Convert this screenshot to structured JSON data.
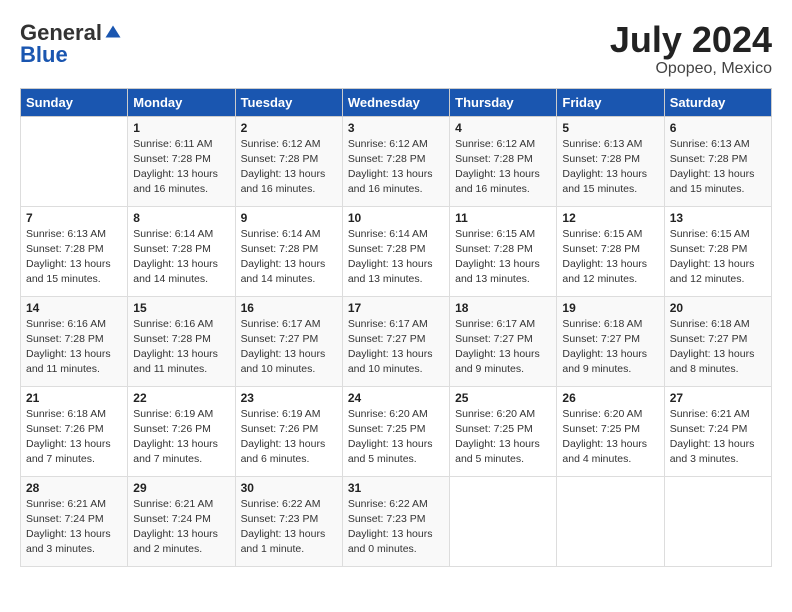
{
  "header": {
    "logo_general": "General",
    "logo_blue": "Blue",
    "month": "July 2024",
    "location": "Opopeo, Mexico"
  },
  "days_of_week": [
    "Sunday",
    "Monday",
    "Tuesday",
    "Wednesday",
    "Thursday",
    "Friday",
    "Saturday"
  ],
  "weeks": [
    [
      {
        "num": "",
        "info": ""
      },
      {
        "num": "1",
        "info": "Sunrise: 6:11 AM\nSunset: 7:28 PM\nDaylight: 13 hours\nand 16 minutes."
      },
      {
        "num": "2",
        "info": "Sunrise: 6:12 AM\nSunset: 7:28 PM\nDaylight: 13 hours\nand 16 minutes."
      },
      {
        "num": "3",
        "info": "Sunrise: 6:12 AM\nSunset: 7:28 PM\nDaylight: 13 hours\nand 16 minutes."
      },
      {
        "num": "4",
        "info": "Sunrise: 6:12 AM\nSunset: 7:28 PM\nDaylight: 13 hours\nand 16 minutes."
      },
      {
        "num": "5",
        "info": "Sunrise: 6:13 AM\nSunset: 7:28 PM\nDaylight: 13 hours\nand 15 minutes."
      },
      {
        "num": "6",
        "info": "Sunrise: 6:13 AM\nSunset: 7:28 PM\nDaylight: 13 hours\nand 15 minutes."
      }
    ],
    [
      {
        "num": "7",
        "info": "Sunrise: 6:13 AM\nSunset: 7:28 PM\nDaylight: 13 hours\nand 15 minutes."
      },
      {
        "num": "8",
        "info": "Sunrise: 6:14 AM\nSunset: 7:28 PM\nDaylight: 13 hours\nand 14 minutes."
      },
      {
        "num": "9",
        "info": "Sunrise: 6:14 AM\nSunset: 7:28 PM\nDaylight: 13 hours\nand 14 minutes."
      },
      {
        "num": "10",
        "info": "Sunrise: 6:14 AM\nSunset: 7:28 PM\nDaylight: 13 hours\nand 13 minutes."
      },
      {
        "num": "11",
        "info": "Sunrise: 6:15 AM\nSunset: 7:28 PM\nDaylight: 13 hours\nand 13 minutes."
      },
      {
        "num": "12",
        "info": "Sunrise: 6:15 AM\nSunset: 7:28 PM\nDaylight: 13 hours\nand 12 minutes."
      },
      {
        "num": "13",
        "info": "Sunrise: 6:15 AM\nSunset: 7:28 PM\nDaylight: 13 hours\nand 12 minutes."
      }
    ],
    [
      {
        "num": "14",
        "info": "Sunrise: 6:16 AM\nSunset: 7:28 PM\nDaylight: 13 hours\nand 11 minutes."
      },
      {
        "num": "15",
        "info": "Sunrise: 6:16 AM\nSunset: 7:28 PM\nDaylight: 13 hours\nand 11 minutes."
      },
      {
        "num": "16",
        "info": "Sunrise: 6:17 AM\nSunset: 7:27 PM\nDaylight: 13 hours\nand 10 minutes."
      },
      {
        "num": "17",
        "info": "Sunrise: 6:17 AM\nSunset: 7:27 PM\nDaylight: 13 hours\nand 10 minutes."
      },
      {
        "num": "18",
        "info": "Sunrise: 6:17 AM\nSunset: 7:27 PM\nDaylight: 13 hours\nand 9 minutes."
      },
      {
        "num": "19",
        "info": "Sunrise: 6:18 AM\nSunset: 7:27 PM\nDaylight: 13 hours\nand 9 minutes."
      },
      {
        "num": "20",
        "info": "Sunrise: 6:18 AM\nSunset: 7:27 PM\nDaylight: 13 hours\nand 8 minutes."
      }
    ],
    [
      {
        "num": "21",
        "info": "Sunrise: 6:18 AM\nSunset: 7:26 PM\nDaylight: 13 hours\nand 7 minutes."
      },
      {
        "num": "22",
        "info": "Sunrise: 6:19 AM\nSunset: 7:26 PM\nDaylight: 13 hours\nand 7 minutes."
      },
      {
        "num": "23",
        "info": "Sunrise: 6:19 AM\nSunset: 7:26 PM\nDaylight: 13 hours\nand 6 minutes."
      },
      {
        "num": "24",
        "info": "Sunrise: 6:20 AM\nSunset: 7:25 PM\nDaylight: 13 hours\nand 5 minutes."
      },
      {
        "num": "25",
        "info": "Sunrise: 6:20 AM\nSunset: 7:25 PM\nDaylight: 13 hours\nand 5 minutes."
      },
      {
        "num": "26",
        "info": "Sunrise: 6:20 AM\nSunset: 7:25 PM\nDaylight: 13 hours\nand 4 minutes."
      },
      {
        "num": "27",
        "info": "Sunrise: 6:21 AM\nSunset: 7:24 PM\nDaylight: 13 hours\nand 3 minutes."
      }
    ],
    [
      {
        "num": "28",
        "info": "Sunrise: 6:21 AM\nSunset: 7:24 PM\nDaylight: 13 hours\nand 3 minutes."
      },
      {
        "num": "29",
        "info": "Sunrise: 6:21 AM\nSunset: 7:24 PM\nDaylight: 13 hours\nand 2 minutes."
      },
      {
        "num": "30",
        "info": "Sunrise: 6:22 AM\nSunset: 7:23 PM\nDaylight: 13 hours\nand 1 minute."
      },
      {
        "num": "31",
        "info": "Sunrise: 6:22 AM\nSunset: 7:23 PM\nDaylight: 13 hours\nand 0 minutes."
      },
      {
        "num": "",
        "info": ""
      },
      {
        "num": "",
        "info": ""
      },
      {
        "num": "",
        "info": ""
      }
    ]
  ]
}
